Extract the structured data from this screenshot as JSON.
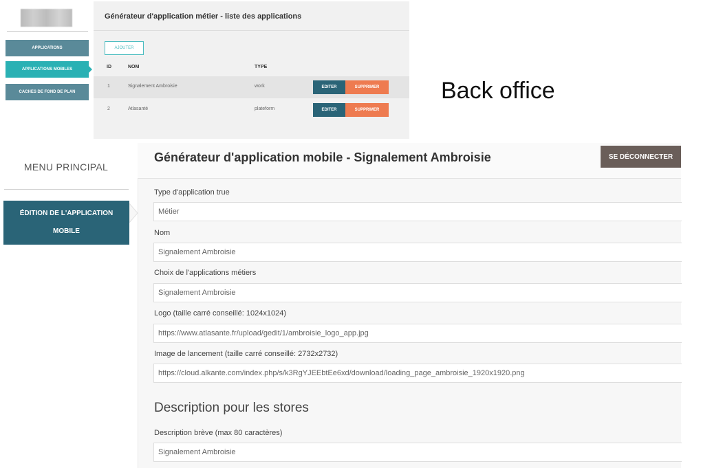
{
  "top": {
    "nav": [
      "APPLICATIONS",
      "APPLICATIONS MOBILES",
      "CACHES DE FOND DE PLAN"
    ],
    "title": "Générateur d'application métier - liste des applications",
    "add_label": "AJOUTER",
    "columns": [
      "ID",
      "NOM",
      "TYPE"
    ],
    "rows": [
      {
        "id": "1",
        "name": "Signalement Ambroisie",
        "type": "work"
      },
      {
        "id": "2",
        "name": "Atlasanté",
        "type": "plateform"
      }
    ],
    "edit_label": "EDITER",
    "delete_label": "SUPPRIMER"
  },
  "caption": "Back office",
  "menu": {
    "title": "MENU PRINCIPAL",
    "item_line1": "ÉDITION DE L'APPLICATION",
    "item_line2": "MOBILE"
  },
  "editor": {
    "title": "Générateur d'application mobile - Signalement Ambroisie",
    "logout_label": "SE DÉCONNECTER",
    "fields": [
      {
        "label": "Type d'application true",
        "value": "Métier"
      },
      {
        "label": "Nom",
        "value": "Signalement Ambroisie"
      },
      {
        "label": "Choix de l'applications métiers",
        "value": "Signalement Ambroisie"
      },
      {
        "label": "Logo (taille carré conseillé: 1024x1024)",
        "value": "https://www.atlasante.fr/upload/gedit/1/ambroisie_logo_app.jpg"
      },
      {
        "label": "Image de lancement (taille carré conseillé: 2732x2732)",
        "value": "https://cloud.alkante.com/index.php/s/k3RgYJEEbtEe6xd/download/loading_page_ambroisie_1920x1920.png"
      }
    ],
    "section_title": "Description pour les stores",
    "short_desc": {
      "label": "Description brève (max 80 caractères)",
      "value": "Signalement Ambroisie"
    }
  }
}
